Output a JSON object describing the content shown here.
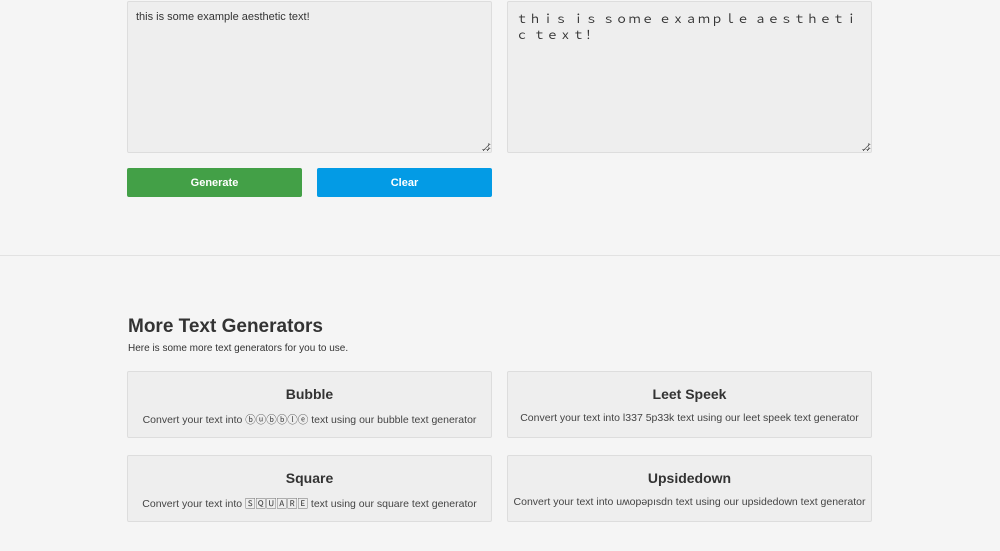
{
  "input_text": "this is some example aesthetic text!",
  "output_text": "ｔｈｉｓ ｉｓ ｓｏｍｅ ｅｘａｍｐｌｅ ａｅｓｔｈｅｔｉｃ ｔｅｘｔ！",
  "buttons": {
    "generate": "Generate",
    "clear": "Clear"
  },
  "colors": {
    "generate": "#43a047",
    "clear": "#039be5"
  },
  "more": {
    "title": "More Text Generators",
    "subtitle": "Here is some more text generators for you to use.",
    "cards": [
      {
        "title": "Bubble",
        "desc": "Convert your text into ⓑⓤⓑⓑⓛⓔ text using our bubble text generator"
      },
      {
        "title": "Leet Speek",
        "desc": "Convert your text into l337 5p33k text using our leet speek text generator"
      },
      {
        "title": "Square",
        "desc": "Convert your text into 🅂🅀🅄🄰🅁🄴 text using our square text generator"
      },
      {
        "title": "Upsidedown",
        "desc": "Convert your text into uʍopǝpısdn text using our upsidedown text generator"
      }
    ]
  }
}
